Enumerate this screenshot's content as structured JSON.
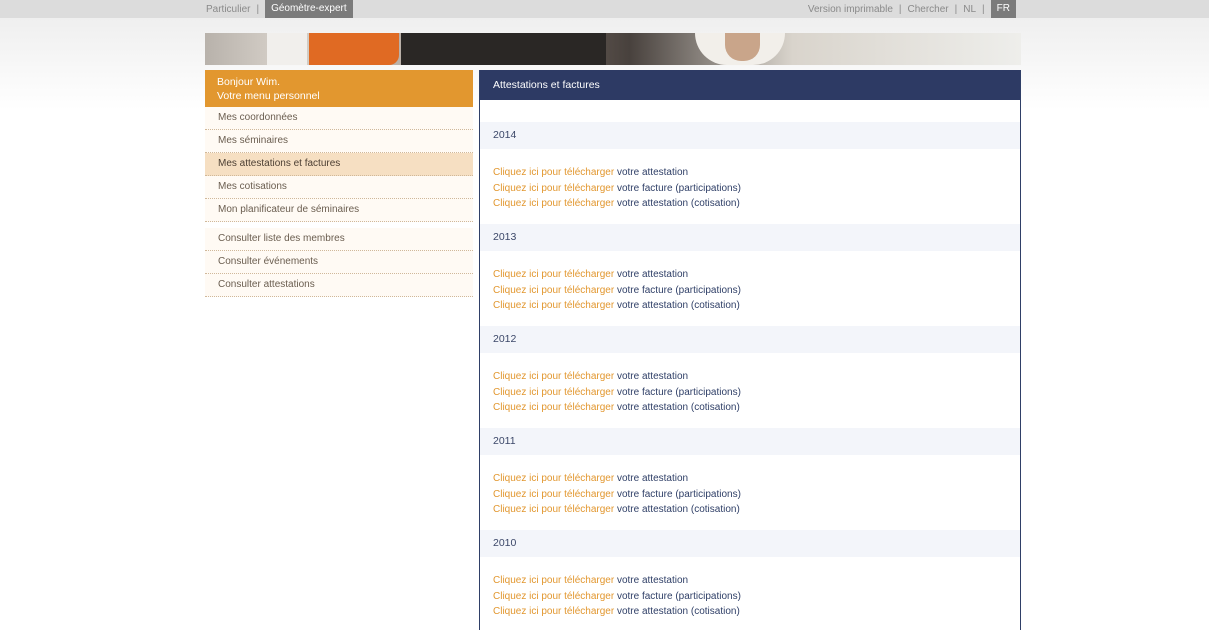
{
  "topbar": {
    "left": [
      {
        "label": "Particulier",
        "active": false
      },
      {
        "label": "Géomètre-expert",
        "active": true
      }
    ],
    "right": {
      "print": "Version imprimable",
      "search": "Chercher",
      "lang_nl": "NL",
      "lang_fr": "FR"
    }
  },
  "sidebar": {
    "greeting": "Bonjour Wim.",
    "subtitle": "Votre menu personnel",
    "items": [
      "Mes coordonnées",
      "Mes séminaires",
      "Mes attestations et factures",
      "Mes cotisations",
      "Mon planificateur de séminaires"
    ],
    "items2": [
      "Consulter liste des membres",
      "Consulter événements",
      "Consulter attestations"
    ]
  },
  "main": {
    "title": "Attestations et factures",
    "cta": "Cliquez ici pour télécharger",
    "doc1": "votre attestation",
    "doc2": "votre facture (participations)",
    "doc3": "votre attestation (cotisation)",
    "years": [
      "2014",
      "2013",
      "2012",
      "2011",
      "2010"
    ]
  }
}
